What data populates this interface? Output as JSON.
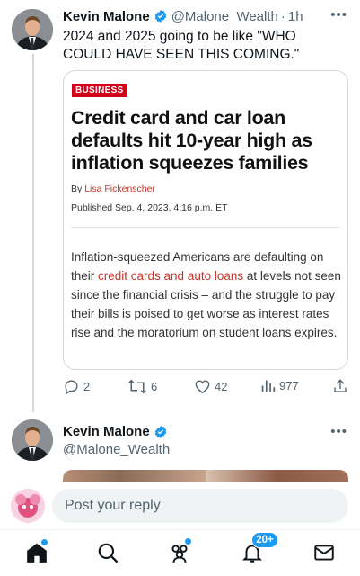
{
  "tweet": {
    "author_name": "Kevin Malone",
    "handle": "@Malone_Wealth",
    "separator": "·",
    "time": "1h",
    "text": "2024 and 2025 going to be like \"WHO COULD HAVE SEEN THIS COMING.\"",
    "more_label": "•••"
  },
  "card": {
    "badge": "BUSINESS",
    "headline": "Credit card and car loan defaults hit 10-year high as inflation squeezes families",
    "byline_prefix": "By",
    "byline_author": "Lisa Fickenscher",
    "published": "Published Sep. 4, 2023, 4:16 p.m. ET",
    "excerpt_before": "Inflation-squeezed Americans are defaulting on their ",
    "excerpt_link": "credit cards and auto loans",
    "excerpt_after": " at levels not seen since the financial crisis – and the struggle to pay their bills is poised to get worse as interest rates rise and the moratorium on student loans expires."
  },
  "actions": {
    "replies": "2",
    "retweets": "6",
    "likes": "42",
    "views": "977"
  },
  "tweet2": {
    "author_name": "Kevin Malone",
    "handle": "@Malone_Wealth",
    "more_label": "•••"
  },
  "reply": {
    "placeholder": "Post your reply"
  },
  "nav": {
    "notifications_badge": "20+",
    "items": [
      "home-icon",
      "search-icon",
      "communities-icon",
      "notifications-icon",
      "messages-icon"
    ]
  },
  "colors": {
    "accent": "#1d9bf0",
    "badge_red": "#d0021b",
    "link_red": "#c0392b",
    "muted": "#536471"
  }
}
